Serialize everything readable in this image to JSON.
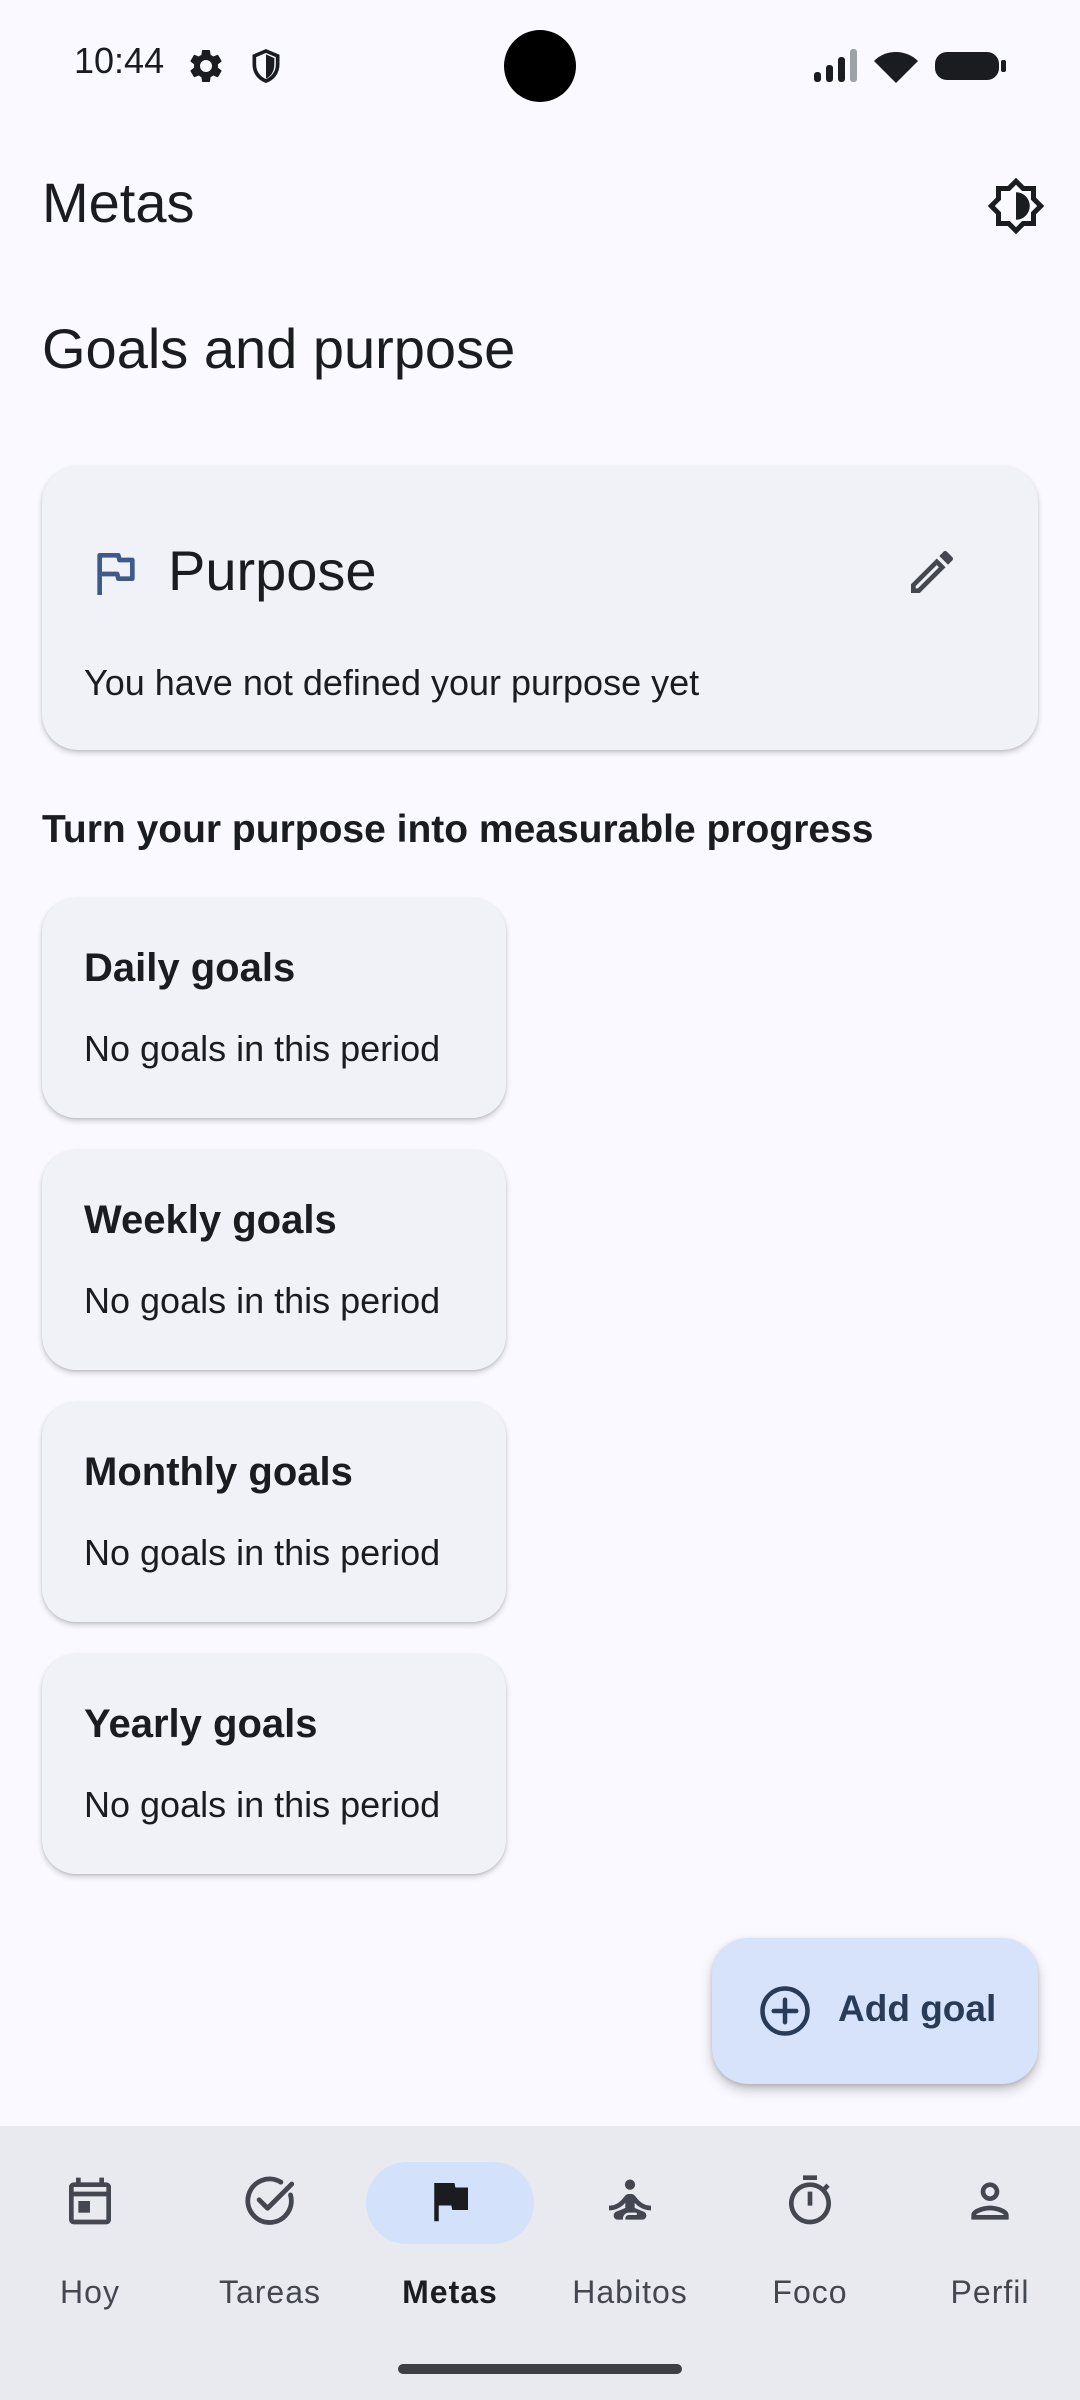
{
  "status_bar": {
    "time": "10:44",
    "icons": [
      "gear-icon",
      "shield-icon",
      "signal-icon",
      "wifi-icon",
      "battery-icon"
    ]
  },
  "app_bar": {
    "title": "Metas",
    "theme_icon": "brightness-icon"
  },
  "section_heading": "Goals and purpose",
  "purpose": {
    "title": "Purpose",
    "icon": "flag-outline-icon",
    "edit_icon": "pencil-icon",
    "text": "You have not defined your purpose yet"
  },
  "subheading": "Turn your purpose into measurable progress",
  "goals": [
    {
      "title": "Daily goals",
      "empty": "No goals in this period"
    },
    {
      "title": "Weekly goals",
      "empty": "No goals in this period"
    },
    {
      "title": "Monthly goals",
      "empty": "No goals in this period"
    },
    {
      "title": "Yearly goals",
      "empty": "No goals in this period"
    }
  ],
  "fab": {
    "label": "Add goal",
    "icon": "add-circle-icon"
  },
  "nav": {
    "selected": "Metas",
    "items": [
      {
        "label": "Hoy",
        "icon": "calendar-icon"
      },
      {
        "label": "Tareas",
        "icon": "check-circle-icon"
      },
      {
        "label": "Metas",
        "icon": "flag-icon"
      },
      {
        "label": "Habitos",
        "icon": "meditation-icon"
      },
      {
        "label": "Foco",
        "icon": "timer-icon"
      },
      {
        "label": "Perfil",
        "icon": "person-icon"
      }
    ]
  },
  "colors": {
    "background": "#f9f9ff",
    "card": "#f0f2f7",
    "accent": "#d7e2fb",
    "primary": "#3f5a8a",
    "text": "#1a1c20",
    "nav_background": "#e8eaf0"
  }
}
